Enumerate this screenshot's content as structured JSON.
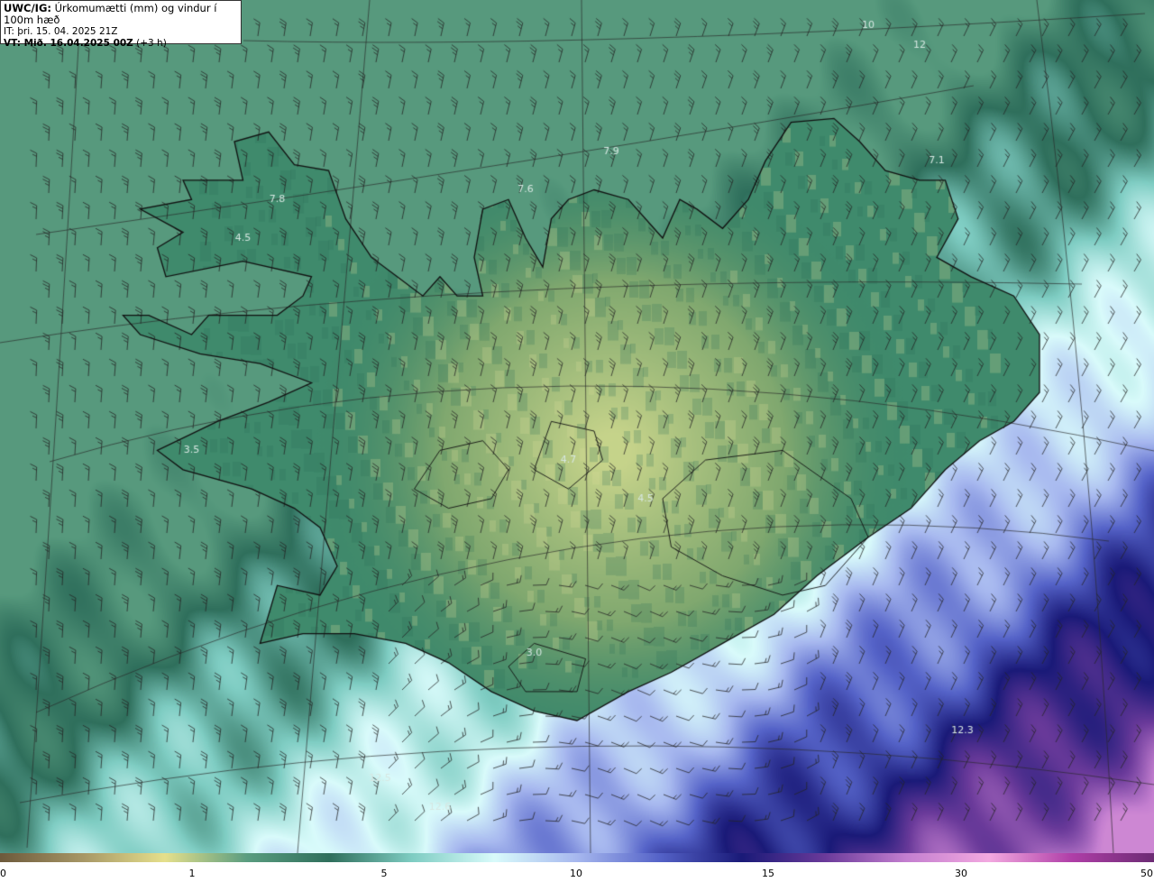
{
  "header": {
    "model": "UWC/IG:",
    "field": " Úrkomumætti (mm) og vindur í 100m hæð",
    "init_label": "IT:",
    "init_time": " þri. 15. 04. 2025 21Z",
    "valid_label": "VT:",
    "valid_time": " Mið. 16.04.2025 00Z",
    "lead": " (+3 h)"
  },
  "colorbar": {
    "ticks": [
      "0",
      "1",
      "5",
      "10",
      "15",
      "30",
      "50"
    ],
    "stops": [
      "#6d5a3c",
      "#a79766",
      "#e6e08c",
      "#5a9d80",
      "#2f6f5c",
      "#7fcdc3",
      "#d9fbfb",
      "#a7b8ef",
      "#5563c8",
      "#1a1a78",
      "#6a3a9a",
      "#c47fd0",
      "#f3a9e0",
      "#b03fa8",
      "#6c2b74"
    ]
  },
  "map": {
    "label_color": "#d7e7e2",
    "values": [
      {
        "text": "4.5",
        "lon": -22.9,
        "lat": 65.9
      },
      {
        "text": "7.8",
        "lon": -22.5,
        "lat": 66.1
      },
      {
        "text": "3.5",
        "lon": -23.5,
        "lat": 64.8
      },
      {
        "text": "7.6",
        "lon": -19.6,
        "lat": 66.15
      },
      {
        "text": "7.9",
        "lon": -18.6,
        "lat": 66.35
      },
      {
        "text": "7.1",
        "lon": -14.8,
        "lat": 66.3
      },
      {
        "text": "4.7",
        "lon": -19.1,
        "lat": 64.75
      },
      {
        "text": "4.5",
        "lon": -18.2,
        "lat": 64.55
      },
      {
        "text": "3.0",
        "lon": -19.5,
        "lat": 63.75
      },
      {
        "text": "12.3",
        "lon": -14.5,
        "lat": 63.35
      },
      {
        "text": "12.5",
        "lon": -21.3,
        "lat": 63.1
      },
      {
        "text": "12.6",
        "lon": -20.6,
        "lat": 62.95
      },
      {
        "text": "10",
        "lon": -15.6,
        "lat": 67.0
      },
      {
        "text": "12",
        "lon": -15.0,
        "lat": 66.9
      }
    ]
  }
}
